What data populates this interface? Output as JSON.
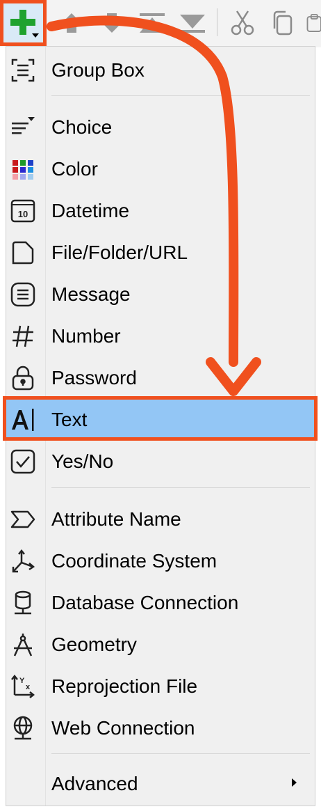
{
  "toolbar": {
    "buttons": [
      {
        "name": "add-parameter-button",
        "icon": "plus-dropdown-icon"
      },
      {
        "name": "move-up-button",
        "icon": "arrow-up-icon"
      },
      {
        "name": "move-down-button",
        "icon": "arrow-down-icon"
      },
      {
        "name": "move-to-top-button",
        "icon": "move-to-top-icon"
      },
      {
        "name": "move-to-bottom-button",
        "icon": "move-to-bottom-icon"
      },
      {
        "name": "cut-button",
        "icon": "scissors-icon"
      },
      {
        "name": "copy-button",
        "icon": "copy-icon"
      },
      {
        "name": "paste-button",
        "icon": "paste-icon"
      }
    ]
  },
  "menu": {
    "group_box": "Group Box",
    "choice": "Choice",
    "color": "Color",
    "datetime": "Datetime",
    "datetime_icon_text": "10",
    "file": "File/Folder/URL",
    "message": "Message",
    "number": "Number",
    "password": "Password",
    "text": "Text",
    "yes_no": "Yes/No",
    "attribute_name": "Attribute Name",
    "coordinate_system": "Coordinate System",
    "database_connection": "Database Connection",
    "geometry": "Geometry",
    "reprojection_file": "Reprojection File",
    "reprojection_icon_text": "Yx",
    "web_connection": "Web Connection",
    "advanced": "Advanced"
  },
  "colors": {
    "highlight_border": "#f0501e",
    "selected_background": "#93c6f5",
    "add_icon": "#1fa22e"
  }
}
